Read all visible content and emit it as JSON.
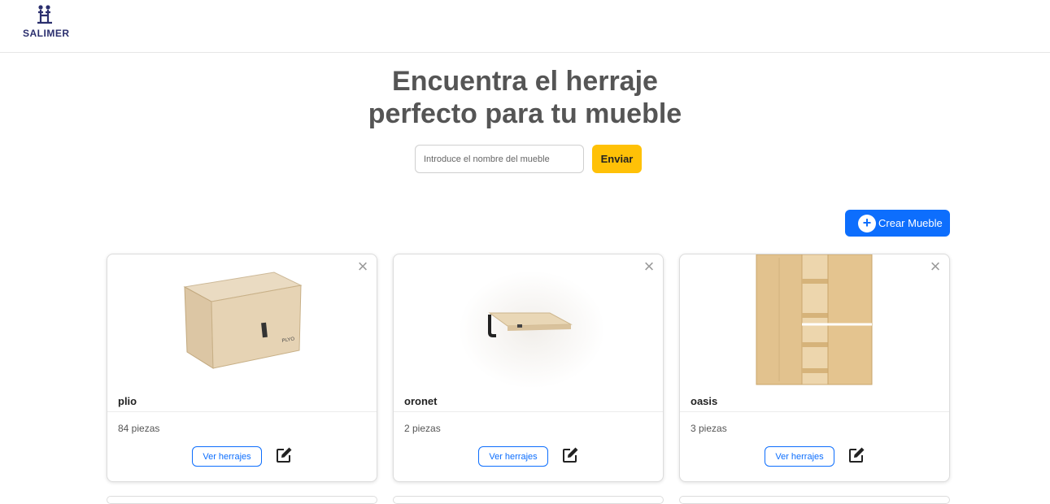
{
  "brand": {
    "name": "SALIMER",
    "color": "#2b2f6e"
  },
  "hero": {
    "line1": "Encuentra el herraje",
    "line2": "perfecto para tu mueble"
  },
  "search": {
    "placeholder": "Introduce el nombre del mueble",
    "submit_label": "Enviar"
  },
  "actions": {
    "create_label": "Crear Mueble",
    "create_icon": "plus-circle-icon"
  },
  "colors": {
    "primary": "#0d6efd",
    "warning": "#ffc107",
    "heading": "#555555"
  },
  "cards": [
    {
      "name": "plio",
      "pieces": "84 piezas",
      "view_label": "Ver herrajes",
      "image": "plyo-box",
      "close_icon": "close-icon",
      "edit_icon": "edit-icon"
    },
    {
      "name": "oronet",
      "pieces": "2 piezas",
      "view_label": "Ver herrajes",
      "image": "wall-shelf",
      "close_icon": "close-icon",
      "edit_icon": "edit-icon"
    },
    {
      "name": "oasis",
      "pieces": "3 piezas",
      "view_label": "Ver herrajes",
      "image": "wooden-cabinet",
      "close_icon": "close-icon",
      "edit_icon": "edit-icon"
    }
  ]
}
